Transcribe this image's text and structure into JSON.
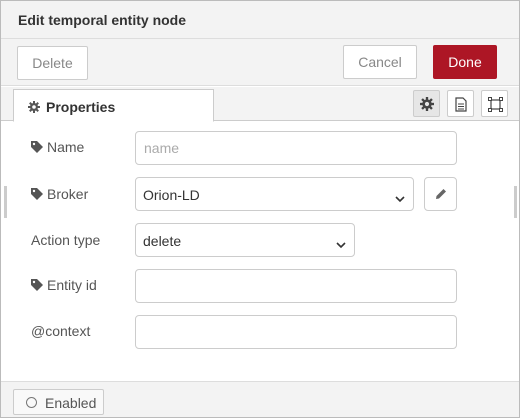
{
  "dialog": {
    "title": "Edit temporal entity node"
  },
  "toolbar": {
    "delete_label": "Delete",
    "cancel_label": "Cancel",
    "done_label": "Done",
    "done_color": "#ad1625"
  },
  "tabs": {
    "properties_label": "Properties",
    "icons": [
      "gear-icon",
      "description-icon",
      "appearance-icon"
    ]
  },
  "form": {
    "name": {
      "label": "Name",
      "value": "",
      "placeholder": "name"
    },
    "broker": {
      "label": "Broker",
      "selected": "Orion-LD"
    },
    "action_type": {
      "label": "Action type",
      "selected": "delete"
    },
    "entity_id": {
      "label": "Entity id",
      "value": ""
    },
    "context": {
      "label": "@context",
      "value": ""
    }
  },
  "footer": {
    "enabled_label": "Enabled"
  }
}
